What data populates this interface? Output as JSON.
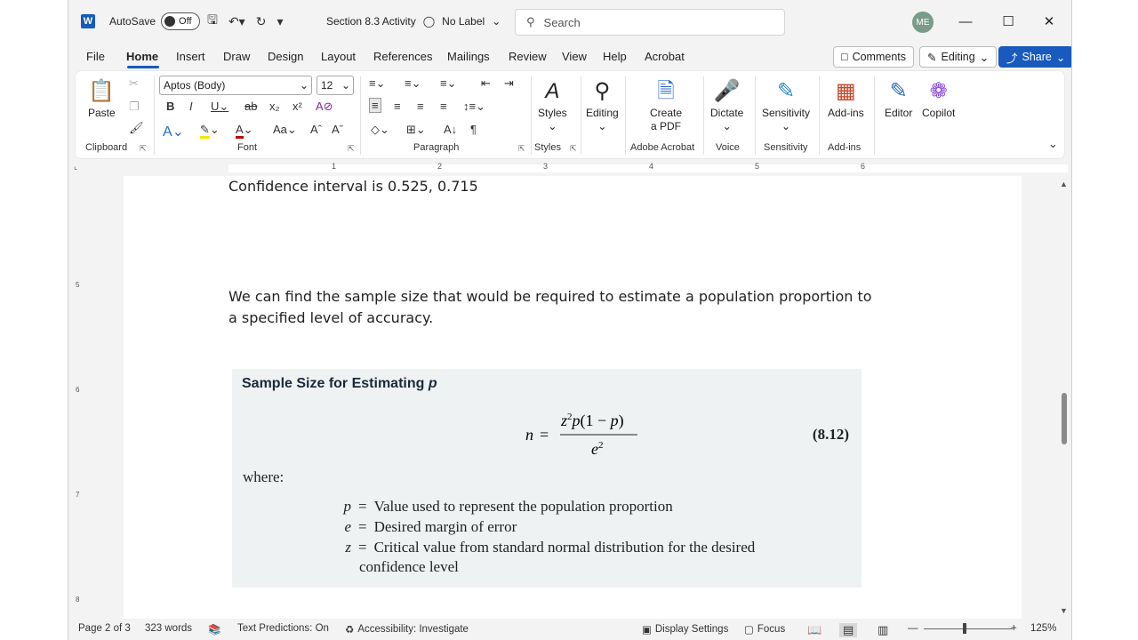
{
  "titlebar": {
    "autosave_label": "AutoSave",
    "autosave_state": "Off",
    "doc_title": "Section 8.3 Activity",
    "label_text": "No Label",
    "search_placeholder": "Search",
    "avatar_initials": "ME"
  },
  "menu": {
    "items": [
      "File",
      "Home",
      "Insert",
      "Draw",
      "Design",
      "Layout",
      "References",
      "Mailings",
      "Review",
      "View",
      "Help",
      "Acrobat"
    ],
    "comments": "Comments",
    "editing": "Editing",
    "share": "Share"
  },
  "ribbon": {
    "paste": "Paste",
    "clipboard": "Clipboard",
    "font_name": "Aptos (Body)",
    "font_size": "12",
    "font": "Font",
    "paragraph": "Paragraph",
    "styles_btn": "Styles",
    "styles": "Styles",
    "editing_btn": "Editing",
    "create_pdf_1": "Create",
    "create_pdf_2": "a PDF",
    "adobe": "Adobe Acrobat",
    "dictate": "Dictate",
    "voice": "Voice",
    "sensitivity_btn": "Sensitivity",
    "sensitivity": "Sensitivity",
    "addins_btn": "Add-ins",
    "addins": "Add-ins",
    "editor": "Editor",
    "copilot": "Copilot"
  },
  "ruler": {
    "numbers": [
      "1",
      "2",
      "3",
      "4",
      "5",
      "6"
    ]
  },
  "vruler": {
    "numbers": [
      "5",
      "6",
      "7",
      "8"
    ]
  },
  "document": {
    "line1": "Confidence interval is 0.525, 0.715",
    "para1": "We can find the sample size that would be required to estimate a population proportion to",
    "para2": "a specified level of accuracy.",
    "box_title": "Sample Size for Estimating ",
    "box_title_var": "p",
    "eq_num": "(8.12)",
    "where": "where:",
    "defs": [
      {
        "sym": "p",
        "text": "Value used to represent the population proportion"
      },
      {
        "sym": "e",
        "text": "Desired margin of error"
      },
      {
        "sym": "z",
        "text": "Critical value from standard normal distribution for the desired"
      }
    ],
    "def_cont": "confidence level"
  },
  "status": {
    "page": "Page 2 of 3",
    "words": "323 words",
    "predictions": "Text Predictions: On",
    "accessibility": "Accessibility: Investigate",
    "display": "Display Settings",
    "focus": "Focus",
    "zoom": "125%"
  }
}
